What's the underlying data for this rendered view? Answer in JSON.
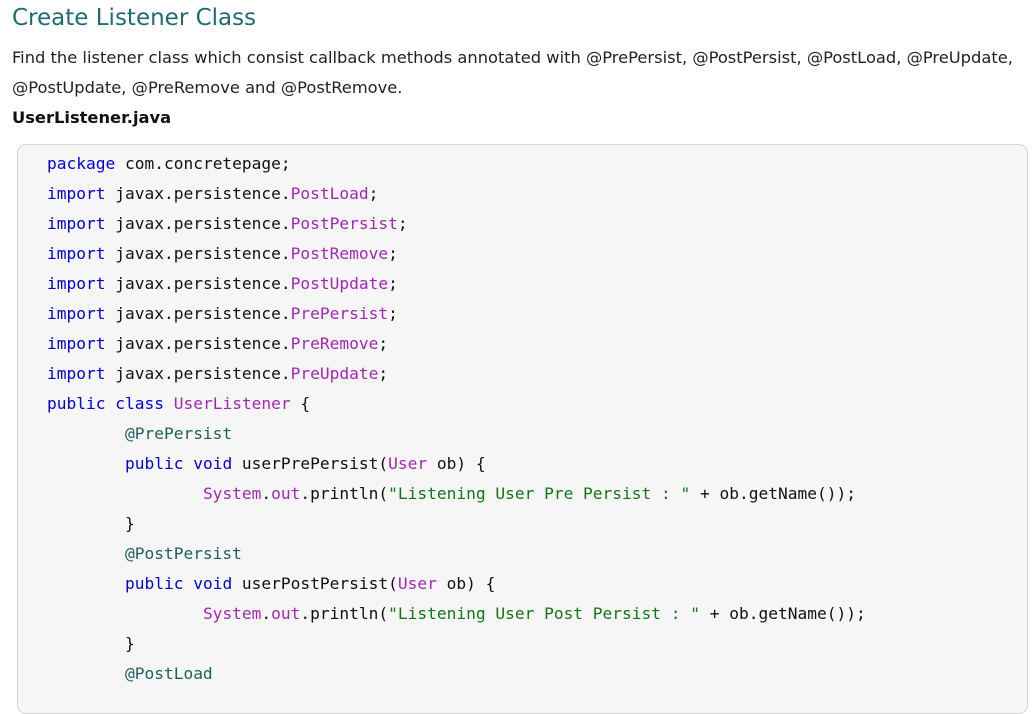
{
  "article": {
    "heading": "Create Listener Class",
    "intro": "Find the listener class which consist callback methods annotated with @PrePersist, @PostPersist, @PostLoad, @PreUpdate, @PostUpdate, @PreRemove and @PostRemove.",
    "filename": "UserListener.java"
  },
  "code": {
    "language": "java",
    "lines": [
      [
        {
          "t": "package",
          "c": "kw"
        },
        {
          "t": " com.concretepage;",
          "c": "pl"
        }
      ],
      [
        {
          "t": "import",
          "c": "kw"
        },
        {
          "t": " javax.persistence.",
          "c": "pl"
        },
        {
          "t": "PostLoad",
          "c": "cls"
        },
        {
          "t": ";",
          "c": "pl"
        }
      ],
      [
        {
          "t": "import",
          "c": "kw"
        },
        {
          "t": " javax.persistence.",
          "c": "pl"
        },
        {
          "t": "PostPersist",
          "c": "cls"
        },
        {
          "t": ";",
          "c": "pl"
        }
      ],
      [
        {
          "t": "import",
          "c": "kw"
        },
        {
          "t": " javax.persistence.",
          "c": "pl"
        },
        {
          "t": "PostRemove",
          "c": "cls"
        },
        {
          "t": ";",
          "c": "pl"
        }
      ],
      [
        {
          "t": "import",
          "c": "kw"
        },
        {
          "t": " javax.persistence.",
          "c": "pl"
        },
        {
          "t": "PostUpdate",
          "c": "cls"
        },
        {
          "t": ";",
          "c": "pl"
        }
      ],
      [
        {
          "t": "import",
          "c": "kw"
        },
        {
          "t": " javax.persistence.",
          "c": "pl"
        },
        {
          "t": "PrePersist",
          "c": "cls"
        },
        {
          "t": ";",
          "c": "pl"
        }
      ],
      [
        {
          "t": "import",
          "c": "kw"
        },
        {
          "t": " javax.persistence.",
          "c": "pl"
        },
        {
          "t": "PreRemove",
          "c": "cls"
        },
        {
          "t": ";",
          "c": "pl"
        }
      ],
      [
        {
          "t": "import",
          "c": "kw"
        },
        {
          "t": " javax.persistence.",
          "c": "pl"
        },
        {
          "t": "PreUpdate",
          "c": "cls"
        },
        {
          "t": ";",
          "c": "pl"
        }
      ],
      [
        {
          "t": "public",
          "c": "kw"
        },
        {
          "t": " ",
          "c": "pl"
        },
        {
          "t": "class",
          "c": "kw"
        },
        {
          "t": " ",
          "c": "pl"
        },
        {
          "t": "UserListener",
          "c": "cls"
        },
        {
          "t": " {",
          "c": "pl"
        }
      ],
      [
        {
          "t": "        ",
          "c": "pl"
        },
        {
          "t": "@PrePersist",
          "c": "ann"
        }
      ],
      [
        {
          "t": "        ",
          "c": "pl"
        },
        {
          "t": "public",
          "c": "kw"
        },
        {
          "t": " ",
          "c": "pl"
        },
        {
          "t": "void",
          "c": "kw"
        },
        {
          "t": " userPrePersist(",
          "c": "pl"
        },
        {
          "t": "User",
          "c": "cls"
        },
        {
          "t": " ob) {",
          "c": "pl"
        }
      ],
      [
        {
          "t": "                ",
          "c": "pl"
        },
        {
          "t": "System",
          "c": "cls"
        },
        {
          "t": ".",
          "c": "pl"
        },
        {
          "t": "out",
          "c": "cls"
        },
        {
          "t": ".println(",
          "c": "pl"
        },
        {
          "t": "\"Listening User Pre Persist : \"",
          "c": "str"
        },
        {
          "t": " + ob.getName());",
          "c": "pl"
        }
      ],
      [
        {
          "t": "        }",
          "c": "pl"
        }
      ],
      [
        {
          "t": "        ",
          "c": "pl"
        },
        {
          "t": "@PostPersist",
          "c": "ann"
        }
      ],
      [
        {
          "t": "        ",
          "c": "pl"
        },
        {
          "t": "public",
          "c": "kw"
        },
        {
          "t": " ",
          "c": "pl"
        },
        {
          "t": "void",
          "c": "kw"
        },
        {
          "t": " userPostPersist(",
          "c": "pl"
        },
        {
          "t": "User",
          "c": "cls"
        },
        {
          "t": " ob) {",
          "c": "pl"
        }
      ],
      [
        {
          "t": "                ",
          "c": "pl"
        },
        {
          "t": "System",
          "c": "cls"
        },
        {
          "t": ".",
          "c": "pl"
        },
        {
          "t": "out",
          "c": "cls"
        },
        {
          "t": ".println(",
          "c": "pl"
        },
        {
          "t": "\"Listening User Post Persist : \"",
          "c": "str"
        },
        {
          "t": " + ob.getName());",
          "c": "pl"
        }
      ],
      [
        {
          "t": "        }",
          "c": "pl"
        }
      ],
      [
        {
          "t": "        ",
          "c": "pl"
        },
        {
          "t": "@PostLoad",
          "c": "ann"
        }
      ]
    ]
  },
  "colors": {
    "heading": "#1e6b73",
    "keyword": "#0000dd",
    "class_name": "#a326b5",
    "annotation": "#1f5f5b",
    "string": "#157515",
    "code_background": "#f6f6f6"
  }
}
